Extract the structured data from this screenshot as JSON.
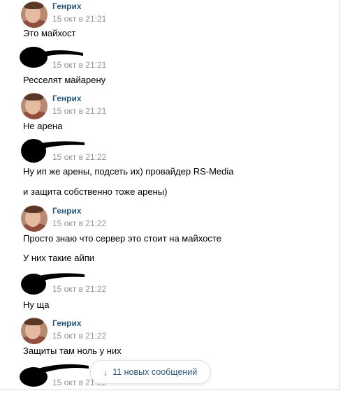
{
  "messages": [
    {
      "author": "Генрих",
      "time": "15 окт в 21:21",
      "lines": [
        "Это майхост"
      ]
    },
    {
      "author": "",
      "time": "15 окт в 21:21",
      "lines": [
        "Ресселят майарену"
      ]
    },
    {
      "author": "Генрих",
      "time": "15 окт в 21:21",
      "lines": [
        "Не арена"
      ]
    },
    {
      "author": "",
      "time": "15 окт в 21:22",
      "lines": [
        "Ну ип же арены, подсеть их) провайдер RS-Media",
        "и защита собственно тоже арены)"
      ]
    },
    {
      "author": "Генрих",
      "time": "15 окт в 21:22",
      "lines": [
        "Просто знаю что сервер это стоит на майхосте",
        "У них такие айпи"
      ]
    },
    {
      "author": "",
      "time": "15 окт в 21:22",
      "lines": [
        "Ну ща"
      ]
    },
    {
      "author": "Генрих",
      "time": "15 окт в 21:22",
      "lines": [
        "Защиты там ноль у них"
      ]
    },
    {
      "author": "",
      "time": "15 окт в 21:22",
      "lines": []
    }
  ],
  "new_messages": {
    "icon": "arrow-down-icon",
    "label": "11 новых сообщений"
  },
  "colors": {
    "name": "#2a5885",
    "time": "#939393",
    "accent": "#5181b8"
  }
}
